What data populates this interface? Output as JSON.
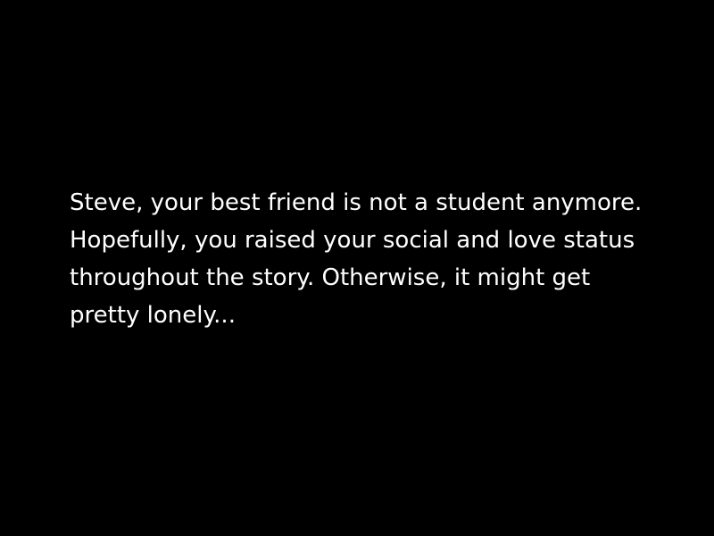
{
  "screen": {
    "background": "#000000",
    "text_color": "#ffffff"
  },
  "narration": {
    "lines": [
      "Steve, your best friend is not a student anymore.",
      "Hopefully, you raised your social and love status",
      "throughout the story. Otherwise, it might get",
      "pretty lonely..."
    ]
  }
}
